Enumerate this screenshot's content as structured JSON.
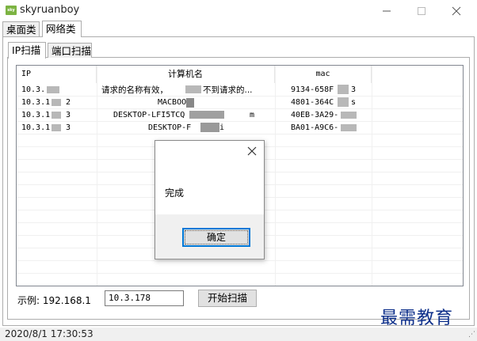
{
  "window": {
    "title": "skyruanboy",
    "icon_name": "app-logo-icon"
  },
  "outer_tabs": [
    {
      "label": "桌面类"
    },
    {
      "label": "网络类"
    }
  ],
  "inner_tabs": [
    {
      "label": "IP扫描"
    },
    {
      "label": "端口扫描"
    }
  ],
  "table": {
    "columns": [
      "IP",
      "计算机名",
      "mac"
    ],
    "rows": [
      {
        "ip": "10.3.",
        "name": "请求的名称有效，",
        "name2": "不到请求的...",
        "mac": "9134-658F",
        "mac2": "3"
      },
      {
        "ip": "10.3.1",
        "ip2": "2",
        "name": "MACBOO",
        "mac": "4801-364C",
        "mac2": "s"
      },
      {
        "ip": "10.3.1",
        "ip2": "3",
        "name": "DESKTOP-LFI5TCQ",
        "name2": "m",
        "mac": "40EB-3A29-"
      },
      {
        "ip": "10.3.1",
        "ip2": "3",
        "name": "DESKTOP-F",
        "name2": "i",
        "mac": "BA01-A9C6-"
      }
    ]
  },
  "controls": {
    "example_label": "示例: 192.168.1",
    "ip_value": "10.3.178",
    "scan_button": "开始扫描"
  },
  "status": {
    "datetime": "2020/8/1 17:30:53"
  },
  "watermark": "最需教育",
  "dialog": {
    "message": "完成",
    "ok_label": "确定"
  }
}
